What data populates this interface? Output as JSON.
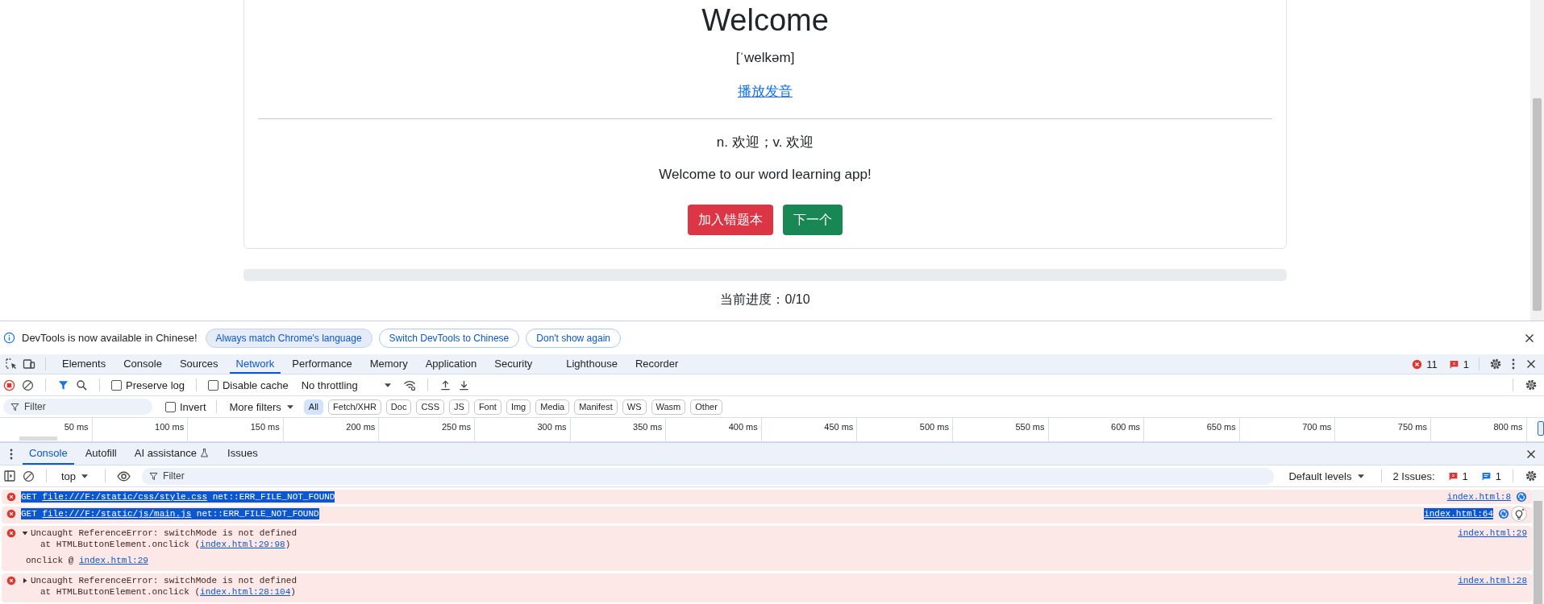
{
  "page": {
    "title": "Welcome",
    "phonetic": "[ˈwelkəm]",
    "play_link": "播放发音",
    "meaning": "n. 欢迎；v. 欢迎",
    "example": "Welcome to our word learning app!",
    "buttons": [
      {
        "label": "加入错题本",
        "kind": "danger"
      },
      {
        "label": "下一个",
        "kind": "success"
      }
    ],
    "progress": {
      "level": 0
    },
    "progress_text": "当前进度：0/10"
  },
  "devtools": {
    "notice": {
      "text": "DevTools is now available in Chinese!",
      "buttons": [
        {
          "label": "Always match Chrome's language",
          "primary": true
        },
        {
          "label": "Switch DevTools to Chinese",
          "primary": false
        },
        {
          "label": "Don't show again",
          "primary": false
        }
      ]
    },
    "tabs": [
      {
        "label": "Elements",
        "selected": false
      },
      {
        "label": "Console",
        "selected": false
      },
      {
        "label": "Sources",
        "selected": false
      },
      {
        "label": "Network",
        "selected": true
      },
      {
        "label": "Performance",
        "selected": false
      },
      {
        "label": "Memory",
        "selected": false
      },
      {
        "label": "Application",
        "selected": false
      },
      {
        "label": "Security",
        "selected": false
      },
      {
        "label": "Lighthouse",
        "selected": false
      },
      {
        "label": "Recorder",
        "selected": false
      }
    ],
    "error_count": "11",
    "issue_count": "1",
    "network_toolbar": {
      "preserve_log": {
        "label": "Preserve log",
        "checked": false
      },
      "disable_cache": {
        "label": "Disable cache",
        "checked": false
      },
      "throttling": "No throttling"
    },
    "network_filter": {
      "placeholder": "Filter",
      "invert": {
        "label": "Invert",
        "checked": false
      },
      "more_filters": "More filters",
      "types": [
        {
          "label": "All",
          "selected": true
        },
        {
          "label": "Fetch/XHR",
          "selected": false
        },
        {
          "label": "Doc",
          "selected": false
        },
        {
          "label": "CSS",
          "selected": false
        },
        {
          "label": "JS",
          "selected": false
        },
        {
          "label": "Font",
          "selected": false
        },
        {
          "label": "Img",
          "selected": false
        },
        {
          "label": "Media",
          "selected": false
        },
        {
          "label": "Manifest",
          "selected": false
        },
        {
          "label": "WS",
          "selected": false
        },
        {
          "label": "Wasm",
          "selected": false
        },
        {
          "label": "Other",
          "selected": false
        }
      ]
    },
    "timeline_ticks": [
      "50 ms",
      "100 ms",
      "150 ms",
      "200 ms",
      "250 ms",
      "300 ms",
      "350 ms",
      "400 ms",
      "450 ms",
      "500 ms",
      "550 ms",
      "600 ms",
      "650 ms",
      "700 ms",
      "750 ms",
      "800 ms"
    ],
    "drawer_tabs": [
      {
        "label": "Console",
        "selected": true
      },
      {
        "label": "Autofill",
        "selected": false
      },
      {
        "label": "AI assistance",
        "selected": false
      },
      {
        "label": "Issues",
        "selected": false
      }
    ],
    "console_toolbar": {
      "context": "top",
      "filter_placeholder": "Filter",
      "levels": "Default levels",
      "issues_label": "2 Issues:",
      "issue_errors": "1",
      "issue_infos": "1"
    },
    "messages": [
      {
        "kind": "network",
        "highlighted": true,
        "method": "GET",
        "url": "file:///F:/static/css/style.css",
        "error": "net::ERR_FILE_NOT_FOUND",
        "source": "index.html:8",
        "source_highlighted": false,
        "insight_button": false
      },
      {
        "kind": "network",
        "highlighted": true,
        "method": "GET",
        "url": "file:///F:/static/js/main.js",
        "error": "net::ERR_FILE_NOT_FOUND",
        "source": "index.html:64",
        "source_highlighted": true,
        "insight_button": true
      },
      {
        "kind": "exception",
        "expanded": true,
        "text": "Uncaught ReferenceError: switchMode is not defined",
        "stack_prefix": "at HTMLButtonElement.onclick (",
        "stack_link": "index.html:29:98",
        "stack_suffix": ")",
        "trace_prefix": "onclick @ ",
        "trace_link": "index.html:29",
        "source": "index.html:29"
      },
      {
        "kind": "exception",
        "expanded": false,
        "text": "Uncaught ReferenceError: switchMode is not defined",
        "stack_prefix": "at HTMLButtonElement.onclick (",
        "stack_link": "index.html:28:104",
        "stack_suffix": ")",
        "source": "index.html:28"
      }
    ]
  }
}
